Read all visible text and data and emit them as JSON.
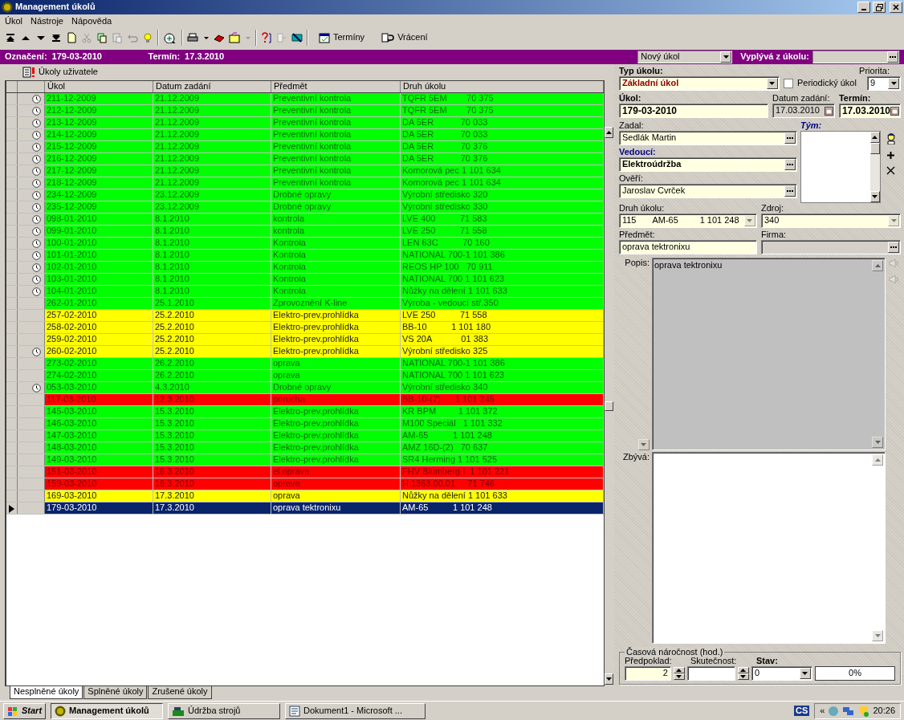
{
  "window": {
    "title": "Management úkolů"
  },
  "menu": [
    "Úkol",
    "Nástroje",
    "Nápověda"
  ],
  "toolbar": {
    "buttons": [
      "Termíny",
      "Vrácení"
    ]
  },
  "header_bar": {
    "mark_label": "Označení:",
    "mark": "179-03-2010",
    "deadline_label": "Termín:",
    "deadline": "17.3.2010",
    "task_type": "Nový úkol",
    "derived_label": "Vyplývá z úkolu:"
  },
  "list_title": "Úkoly uživatele",
  "table": {
    "columns": [
      "Úkol",
      "Datum zadání",
      "Předmět",
      "Druh úkolu"
    ],
    "rows": [
      {
        "cells": [
          "211-12-2009",
          "21.12.2009",
          "Preventivní kontrola",
          "TQFR 5EM        70 375"
        ],
        "color": "#00ff00",
        "flag": true,
        "selected": false
      },
      {
        "cells": [
          "212-12-2009",
          "21.12.2009",
          "Preventivní kontrola",
          "TQFR 5EM        70 375"
        ],
        "color": "#00ff00",
        "flag": true,
        "selected": false
      },
      {
        "cells": [
          "213-12-2009",
          "21.12.2009",
          "Preventivní kontrola",
          "DA 5ER           70 033"
        ],
        "color": "#00ff00",
        "flag": true,
        "selected": false
      },
      {
        "cells": [
          "214-12-2009",
          "21.12.2009",
          "Preventivní kontrola",
          "DA 5ER           70 033"
        ],
        "color": "#00ff00",
        "flag": true,
        "selected": false
      },
      {
        "cells": [
          "215-12-2009",
          "21.12.2009",
          "Preventivní kontrola",
          "DA 5ER           70 376"
        ],
        "color": "#00ff00",
        "flag": true,
        "selected": false
      },
      {
        "cells": [
          "216-12-2009",
          "21.12.2009",
          "Preventivní kontrola",
          "DA 5ER           70 376"
        ],
        "color": "#00ff00",
        "flag": true,
        "selected": false
      },
      {
        "cells": [
          "217-12-2009",
          "21.12.2009",
          "Preventivní kontrola",
          "Komorová pec 1 101 634"
        ],
        "color": "#00ff00",
        "flag": true,
        "selected": false
      },
      {
        "cells": [
          "218-12-2009",
          "21.12.2009",
          "Preventivní kontrola",
          "Komorová pec 1 101 634"
        ],
        "color": "#00ff00",
        "flag": true,
        "selected": false
      },
      {
        "cells": [
          "234-12-2009",
          "23.12.2009",
          "Drobné opravy",
          "Výrobní středisko 320"
        ],
        "color": "#00ff00",
        "flag": true,
        "selected": false
      },
      {
        "cells": [
          "235-12-2009",
          "23.12.2009",
          "Drobné opravy",
          "Výrobní středisko 330"
        ],
        "color": "#00ff00",
        "flag": true,
        "selected": false
      },
      {
        "cells": [
          "098-01-2010",
          "8.1.2010",
          "kontrola",
          "LVE 400          71 583"
        ],
        "color": "#00ff00",
        "flag": true,
        "selected": false
      },
      {
        "cells": [
          "099-01-2010",
          "8.1.2010",
          "kontrola",
          "LVE 250          71 558"
        ],
        "color": "#00ff00",
        "flag": true,
        "selected": false
      },
      {
        "cells": [
          "100-01-2010",
          "8.1.2010",
          "Kontrola",
          "LEN 63C          70 160"
        ],
        "color": "#00ff00",
        "flag": true,
        "selected": false
      },
      {
        "cells": [
          "101-01-2010",
          "8.1.2010",
          "Kontrola",
          "NATIONAL 700-1 101 386"
        ],
        "color": "#00ff00",
        "flag": true,
        "selected": false
      },
      {
        "cells": [
          "102-01-2010",
          "8.1.2010",
          "Kontrola",
          "REOS HP 100   70 911"
        ],
        "color": "#00ff00",
        "flag": true,
        "selected": false
      },
      {
        "cells": [
          "103-01-2010",
          "8.1.2010",
          "Kontrola",
          "NATIONAL 700 1 101 623"
        ],
        "color": "#00ff00",
        "flag": true,
        "selected": false
      },
      {
        "cells": [
          "104-01-2010",
          "8.1.2010",
          "Kontrola",
          "Nůžky na dělení 1 101 633"
        ],
        "color": "#00ff00",
        "flag": true,
        "selected": false
      },
      {
        "cells": [
          "262-01-2010",
          "25.1.2010",
          "Zprovoznění K-line",
          "Výroba - vedoucí stř.350"
        ],
        "color": "#00ff00",
        "flag": false,
        "selected": false
      },
      {
        "cells": [
          "257-02-2010",
          "25.2.2010",
          "Elektro-prev.prohlídka",
          "LVE 250          71 558"
        ],
        "color": "#ffff00",
        "flag": false,
        "selected": false
      },
      {
        "cells": [
          "258-02-2010",
          "25.2.2010",
          "Elektro-prev.prohlídka",
          "BB-10          1 101 180"
        ],
        "color": "#ffff00",
        "flag": false,
        "selected": false
      },
      {
        "cells": [
          "259-02-2010",
          "25.2.2010",
          "Elektro-prev.prohlídka",
          "VS 20A            01 383"
        ],
        "color": "#ffff00",
        "flag": false,
        "selected": false
      },
      {
        "cells": [
          "260-02-2010",
          "25.2.2010",
          "Elektro-prev.prohlídka",
          "Výrobní středisko 325"
        ],
        "color": "#ffff00",
        "flag": true,
        "selected": false
      },
      {
        "cells": [
          "273-02-2010",
          "26.2.2010",
          "oprava",
          "NATIONAL 700-1 101 386"
        ],
        "color": "#00ff00",
        "flag": false,
        "selected": false
      },
      {
        "cells": [
          "274-02-2010",
          "26.2.2010",
          "oprava",
          "NATIONAL 700 1 101 623"
        ],
        "color": "#00ff00",
        "flag": false,
        "selected": false
      },
      {
        "cells": [
          "053-03-2010",
          "4.3.2010",
          "Drobné opravy",
          "Výrobní středisko 340"
        ],
        "color": "#00ff00",
        "flag": true,
        "selected": false
      },
      {
        "cells": [
          "117-03-2010",
          "12.3.2010",
          "porucha",
          "BB-10-(7)      1 101 245"
        ],
        "color": "#ff0000",
        "flag": false,
        "selected": false
      },
      {
        "cells": [
          "145-03-2010",
          "15.3.2010",
          "Elektro-prev.prohlídka",
          "KR BPM         1 101 372"
        ],
        "color": "#00ff00",
        "flag": false,
        "selected": false
      },
      {
        "cells": [
          "146-03-2010",
          "15.3.2010",
          "Elektro-prev.prohlídka",
          "M100 Speciál   1 101 332"
        ],
        "color": "#00ff00",
        "flag": false,
        "selected": false
      },
      {
        "cells": [
          "147-03-2010",
          "15.3.2010",
          "Elektro-prev.prohlídka",
          "AM-65          1 101 248"
        ],
        "color": "#00ff00",
        "flag": false,
        "selected": false
      },
      {
        "cells": [
          "148-03-2010",
          "15.3.2010",
          "Elektro-prev.prohlídka",
          "AMZ 16D-(2)   70 637"
        ],
        "color": "#00ff00",
        "flag": false,
        "selected": false
      },
      {
        "cells": [
          "149-03-2010",
          "15.3.2010",
          "Elektro-prev.prohlídka",
          "SR4 Herming 1 101 525"
        ],
        "color": "#00ff00",
        "flag": false,
        "selected": false
      },
      {
        "cells": [
          "151-03-2010",
          "16.3.2010",
          "el.oprava",
          "FHV Blumberg I  1 101 221"
        ],
        "color": "#ff0000",
        "flag": false,
        "selected": false
      },
      {
        "cells": [
          "159-03-2010",
          "16.3.2010",
          "oprava",
          "H 1363.00.01     71 746"
        ],
        "color": "#ff0000",
        "flag": false,
        "selected": false
      },
      {
        "cells": [
          "169-03-2010",
          "17.3.2010",
          "oprava",
          "Nůžky na dělení 1 101 633"
        ],
        "color": "#ffff00",
        "flag": false,
        "selected": false
      },
      {
        "cells": [
          "179-03-2010",
          "17.3.2010",
          "oprava tektronixu",
          "AM-65          1 101 248"
        ],
        "color": "#0a246a",
        "flag": false,
        "selected": true
      }
    ]
  },
  "bottom_tabs": [
    {
      "label": "Nesplněné úkoly",
      "selected": true
    },
    {
      "label": "Splněné úkoly",
      "selected": false
    },
    {
      "label": "Zrušené úkoly",
      "selected": false
    }
  ],
  "form": {
    "type_label": "Typ úkolu:",
    "type": "Základní úkol",
    "periodic_label": "Periodický úkol",
    "periodic": false,
    "priority_label": "Priorita:",
    "priority": "9",
    "task_label": "Úkol:",
    "task": "179-03-2010",
    "assigned_date_label": "Datum zadání:",
    "assigned_date": "17.03.2010",
    "deadline_label": "Termín:",
    "deadline": "17.03.2010",
    "assigned_by_label": "Zadal:",
    "assigned_by": "Sedlák Martin",
    "team_label": "Tým:",
    "leader_label": "Vedoucí:",
    "leader": "Elektroúdržba",
    "verifier_label": "Ověří:",
    "verifier": "Jaroslav Cvrček",
    "kind_label": "Druh úkolu:",
    "kind_values": [
      "115",
      "AM-65",
      "1 101 248"
    ],
    "source_label": "Zdroj:",
    "source": "340",
    "subject_label": "Předmět:",
    "subject": "oprava tektronixu",
    "company_label": "Firma:",
    "description_label": "Popis:",
    "description": "oprava tektronixu",
    "remaining_label": "Zbývá:",
    "time_group": "Časová náročnost (hod.)",
    "estimate_label": "Předpoklad:",
    "estimate": "2",
    "actual_label": "Skutečnost:",
    "state_label": "Stav:",
    "state": "0",
    "progress": {
      "level": 0,
      "reading": "0%"
    }
  },
  "taskbar": {
    "start": "Start",
    "items": [
      {
        "label": "Management úkolů",
        "selected": true
      },
      {
        "label": "Údržba strojů",
        "selected": false
      },
      {
        "label": "Dokument1 - Microsoft ...",
        "selected": false
      }
    ],
    "tray_language": "CS",
    "tray_expand": "«",
    "clock": "20:26"
  }
}
